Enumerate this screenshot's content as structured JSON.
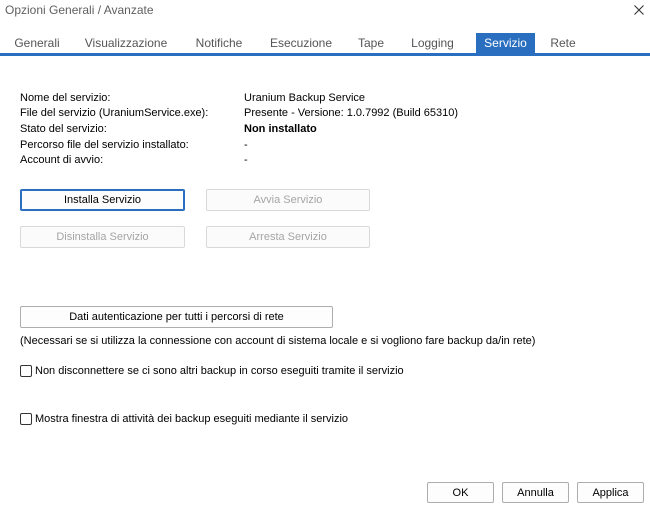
{
  "window": {
    "title": "Opzioni Generali / Avanzate",
    "close_icon": "close-icon"
  },
  "tabs": [
    {
      "label": "Generali",
      "active": false
    },
    {
      "label": "Visualizzazione",
      "active": false
    },
    {
      "label": "Notifiche",
      "active": false
    },
    {
      "label": "Esecuzione",
      "active": false
    },
    {
      "label": "Tape",
      "active": false
    },
    {
      "label": "Logging",
      "active": false
    },
    {
      "label": "Servizio",
      "active": true
    },
    {
      "label": "Rete",
      "active": false
    }
  ],
  "service_info": [
    {
      "label": "Nome del servizio:",
      "value": "Uranium Backup Service"
    },
    {
      "label": "File del servizio (UraniumService.exe):",
      "value": "Presente - Versione: 1.0.7992 (Build 65310)"
    },
    {
      "label": "Stato del servizio:",
      "value": "Non installato"
    },
    {
      "label": "Percorso file del servizio installato:",
      "value": "-"
    },
    {
      "label": "Account di avvio:",
      "value": "-"
    }
  ],
  "buttons": {
    "install": "Installa Servizio",
    "start": "Avvia Servizio",
    "uninstall": "Disinstalla Servizio",
    "stop": "Arresta Servizio",
    "credentials": "Dati autenticazione per tutti i percorsi di rete"
  },
  "credentials_note": "(Necessari se si utilizza la connessione con account di sistema locale e si vogliono fare backup da/in rete)",
  "checkboxes": [
    {
      "label": "Non disconnettere se ci sono altri backup in corso eseguiti tramite il servizio",
      "checked": false
    },
    {
      "label": "Mostra finestra di attività dei backup eseguiti mediante il servizio",
      "checked": false
    }
  ],
  "footer": {
    "ok": "OK",
    "cancel": "Annulla",
    "apply": "Applica"
  },
  "colors": {
    "accent": "#2a6fbf"
  }
}
